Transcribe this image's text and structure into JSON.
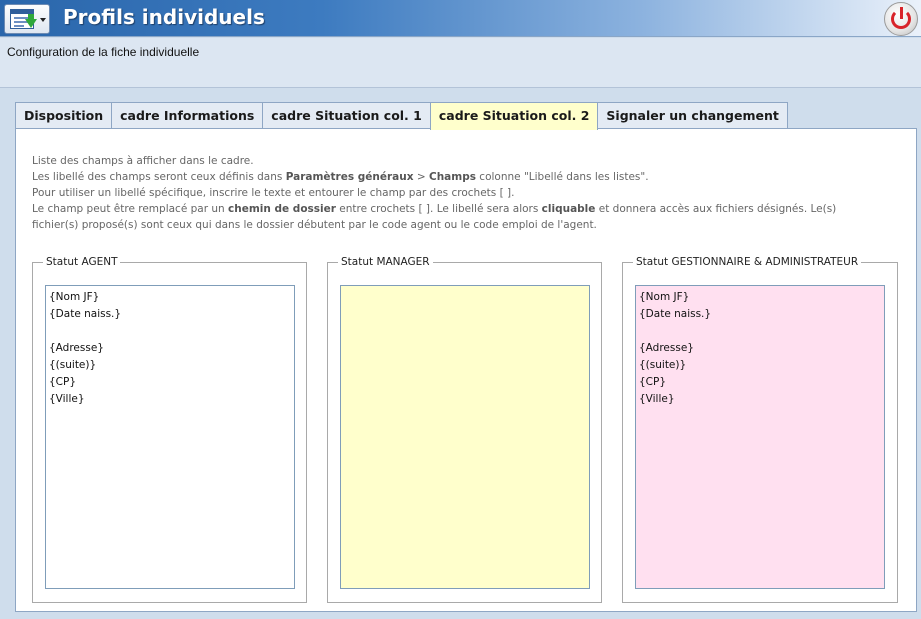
{
  "window": {
    "title": "Profils individuels"
  },
  "header": {
    "subtitle": "Configuration de la fiche individuelle"
  },
  "tabs": [
    {
      "label": "Disposition",
      "active": false
    },
    {
      "label": "cadre Informations",
      "active": false
    },
    {
      "label": "cadre Situation col. 1",
      "active": false
    },
    {
      "label": "cadre Situation col. 2",
      "active": true
    },
    {
      "label": "Signaler un changement",
      "active": false
    }
  ],
  "info": {
    "line1": "Liste des champs à afficher dans le cadre.",
    "line2_a": "Les libellé des champs seront ceux définis dans ",
    "line2_b": "Paramètres généraux",
    "line2_c": " > ",
    "line2_d": "Champs",
    "line2_e": " colonne \"Libellé dans les listes\".",
    "line3": "Pour utiliser un libellé spécifique, inscrire le texte et entourer le champ par des crochets [ ].",
    "line4_a": "Le champ peut être remplacé par un ",
    "line4_b": "chemin de dossier",
    "line4_c": " entre crochets [ ]. Le libellé sera alors ",
    "line4_d": "cliquable",
    "line4_e": " et donnera accès aux fichiers désignés. Le(s)",
    "line5": "fichier(s) proposé(s) sont ceux qui dans le dossier débutent par le code agent ou le code emploi de l'agent."
  },
  "groups": {
    "agent": {
      "label": "Statut AGENT",
      "value": "{Nom JF}\n{Date naiss.}\n\n{Adresse}\n{(suite)}\n{CP}\n{Ville}",
      "bg": "#ffffff"
    },
    "manager": {
      "label": "Statut MANAGER",
      "value": "",
      "bg": "#ffffcc"
    },
    "gestionnaire": {
      "label": "Statut GESTIONNAIRE & ADMINISTRATEUR",
      "value": "{Nom JF}\n{Date naiss.}\n\n{Adresse}\n{(suite)}\n{CP}\n{Ville}",
      "bg": "#ffe0f0"
    }
  }
}
